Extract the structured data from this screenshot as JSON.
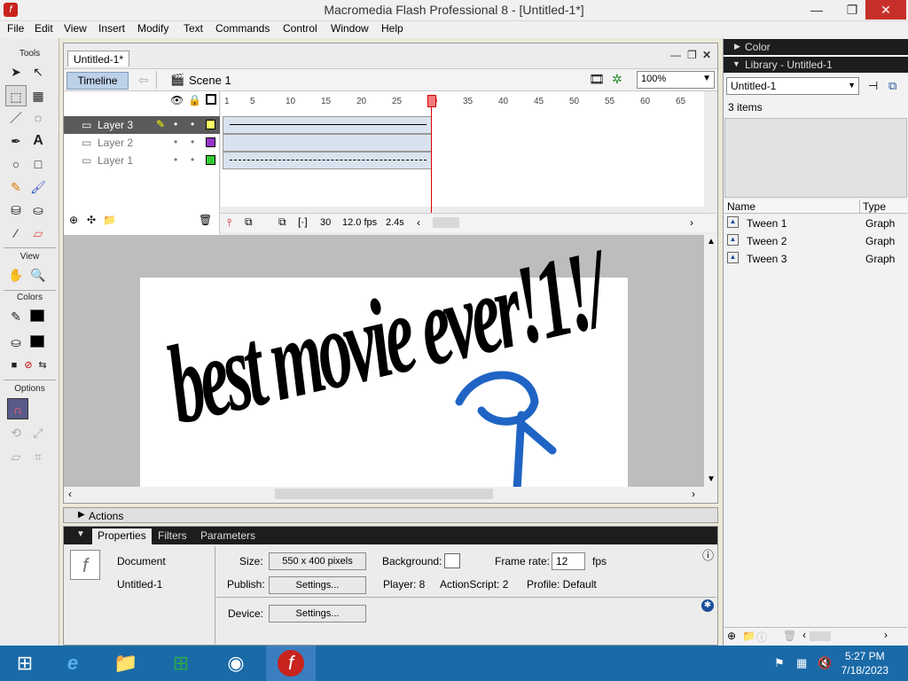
{
  "window": {
    "title": "Macromedia Flash Professional 8 - [Untitled-1*]",
    "min": "—",
    "max": "❐",
    "close": "✕"
  },
  "menu": [
    "File",
    "Edit",
    "View",
    "Insert",
    "Modify",
    "Text",
    "Commands",
    "Control",
    "Window",
    "Help"
  ],
  "tools": {
    "header": "Tools",
    "view": "View",
    "colors": "Colors",
    "options": "Options"
  },
  "document": {
    "tab": "Untitled-1*",
    "timeline_btn": "Timeline",
    "scene": "Scene 1",
    "zoom": "100%"
  },
  "layers": [
    {
      "name": "Layer 3",
      "color": "#ffff66"
    },
    {
      "name": "Layer 2",
      "color": "#9933cc"
    },
    {
      "name": "Layer 1",
      "color": "#33cc33"
    }
  ],
  "frame_numbers": [
    "1",
    "5",
    "10",
    "15",
    "20",
    "25",
    "30",
    "35",
    "40",
    "45",
    "50",
    "55",
    "60",
    "65"
  ],
  "status": {
    "frame": "30",
    "fps": "12.0 fps",
    "time": "2.4s"
  },
  "stage_text": "best movie ever!1!/",
  "actions": {
    "label": "Actions"
  },
  "properties": {
    "tabs": [
      "Properties",
      "Filters",
      "Parameters"
    ],
    "doc_label": "Document",
    "doc_name": "Untitled-1",
    "size_label": "Size:",
    "size_value": "550 x 400 pixels",
    "bg_label": "Background:",
    "fr_label": "Frame rate:",
    "fr_value": "12",
    "fps": "fps",
    "publish_label": "Publish:",
    "settings": "Settings...",
    "player": "Player: 8",
    "actionscript": "ActionScript:  2",
    "profile": "Profile:  Default",
    "device_label": "Device:"
  },
  "library": {
    "color_header": "Color",
    "header": "Library - Untitled-1",
    "select": "Untitled-1",
    "count": "3 items",
    "col_name": "Name",
    "col_type": "Type",
    "items": [
      {
        "name": "Tween 1",
        "type": "Graph"
      },
      {
        "name": "Tween 2",
        "type": "Graph"
      },
      {
        "name": "Tween 3",
        "type": "Graph"
      }
    ]
  },
  "taskbar": {
    "time": "5:27 PM",
    "date": "7/18/2023"
  }
}
